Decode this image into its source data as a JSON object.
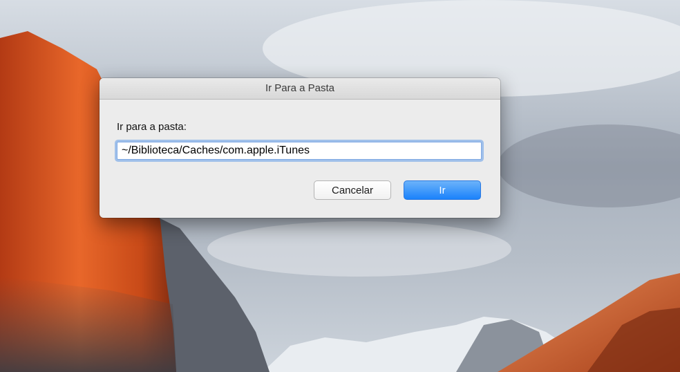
{
  "dialog": {
    "title": "Ir Para a Pasta",
    "label": "Ir para a pasta:",
    "path_value": "~/Biblioteca/Caches/com.apple.iTunes",
    "cancel_label": "Cancelar",
    "go_label": "Ir"
  },
  "colors": {
    "accent": "#1a82fb",
    "focus_ring": "#639cea",
    "dialog_bg": "#ececec"
  }
}
